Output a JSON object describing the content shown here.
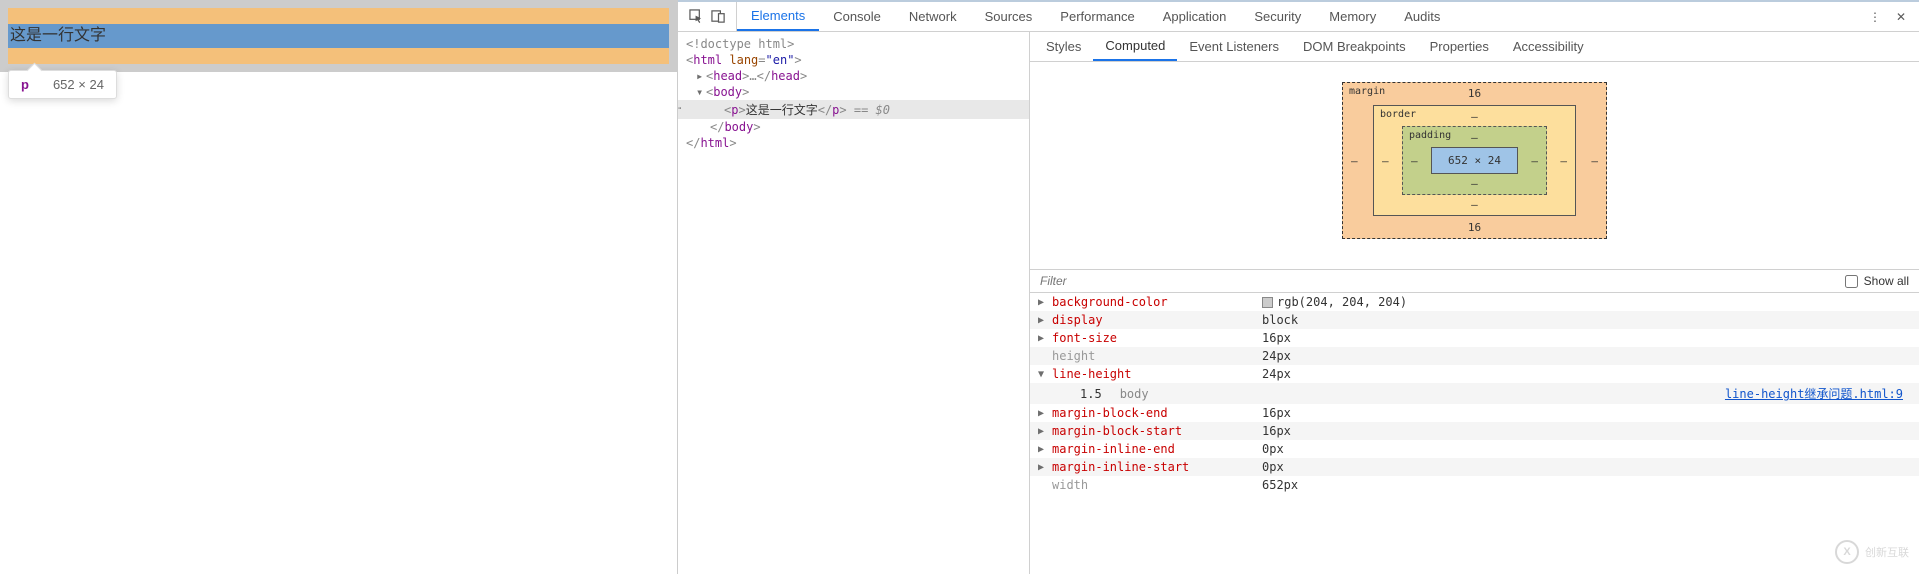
{
  "page": {
    "p_text": "这是一行文字"
  },
  "tooltip": {
    "tag": "p",
    "dims": "652 × 24"
  },
  "devtools_tabs": [
    "Elements",
    "Console",
    "Network",
    "Sources",
    "Performance",
    "Application",
    "Security",
    "Memory",
    "Audits"
  ],
  "devtools_active_tab": "Elements",
  "dom": {
    "doctype": "<!doctype html>",
    "html_open": "html",
    "html_lang_attr": "lang",
    "html_lang_val": "\"en\"",
    "head": "head",
    "head_ellipsis": "…",
    "body": "body",
    "p": "p",
    "p_text": "这是一行文字",
    "eq0": " == $0"
  },
  "side_tabs": [
    "Styles",
    "Computed",
    "Event Listeners",
    "DOM Breakpoints",
    "Properties",
    "Accessibility"
  ],
  "side_active_tab": "Computed",
  "box_model": {
    "margin_label": "margin",
    "border_label": "border",
    "padding_label": "padding",
    "content": "652 × 24",
    "margin_top": "16",
    "margin_bottom": "16",
    "margin_left": "–",
    "margin_right": "–",
    "border_top": "–",
    "border_bottom": "–",
    "border_left": "–",
    "border_right": "–",
    "padding_top": "–",
    "padding_bottom": "–",
    "padding_left": "–",
    "padding_right": "–"
  },
  "filter_placeholder": "Filter",
  "show_all_label": "Show all",
  "computed": [
    {
      "name": "background-color",
      "value": "rgb(204, 204, 204)",
      "swatch": true,
      "muted": false,
      "expanded": false
    },
    {
      "name": "display",
      "value": "block",
      "muted": false,
      "expanded": false
    },
    {
      "name": "font-size",
      "value": "16px",
      "muted": false,
      "expanded": false
    },
    {
      "name": "height",
      "value": "24px",
      "muted": true,
      "expanded": false
    },
    {
      "name": "line-height",
      "value": "24px",
      "muted": false,
      "expanded": true,
      "sub": {
        "val": "1.5",
        "src": "body",
        "link": "line-height继承问题.html:9"
      }
    },
    {
      "name": "margin-block-end",
      "value": "16px",
      "muted": false,
      "expanded": false
    },
    {
      "name": "margin-block-start",
      "value": "16px",
      "muted": false,
      "expanded": false
    },
    {
      "name": "margin-inline-end",
      "value": "0px",
      "muted": false,
      "expanded": false
    },
    {
      "name": "margin-inline-start",
      "value": "0px",
      "muted": false,
      "expanded": false
    },
    {
      "name": "width",
      "value": "652px",
      "muted": true,
      "expanded": false
    }
  ],
  "watermark": {
    "logo": "X",
    "text": "创新互联"
  }
}
